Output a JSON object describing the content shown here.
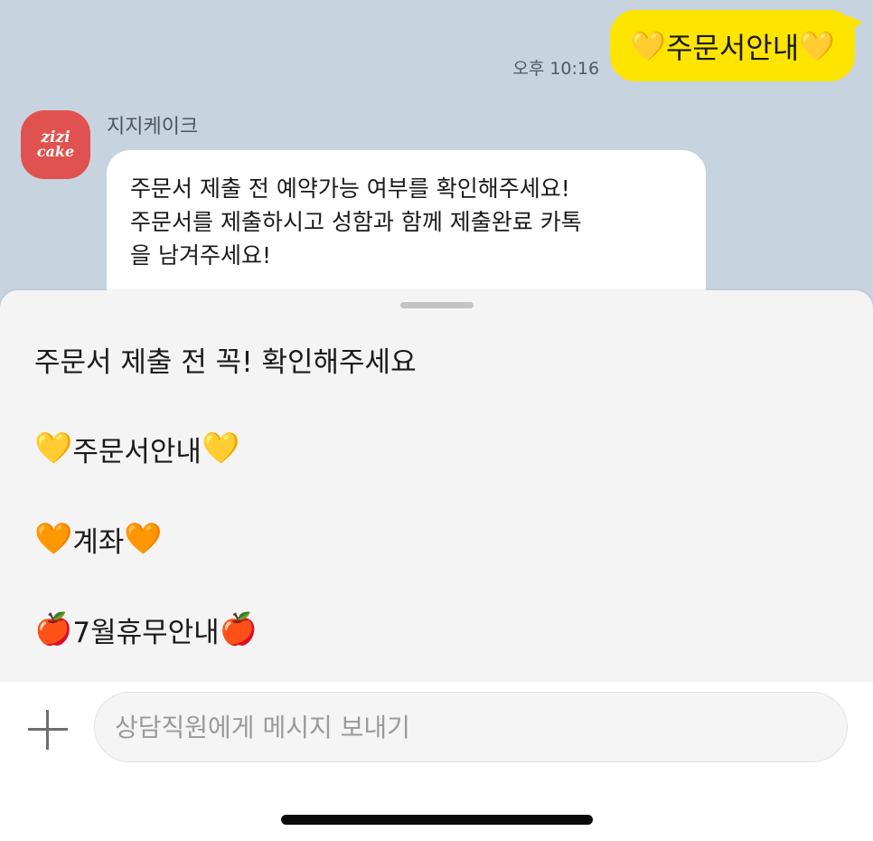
{
  "chat": {
    "sent": {
      "time": "오후 10:16",
      "emoji_left": "💛",
      "text": "주문서안내",
      "emoji_right": "💛"
    },
    "sender": {
      "name": "지지케이크",
      "avatar_line1": "zizi",
      "avatar_line2": "cake"
    },
    "received": {
      "lines": [
        "주문서 제출 전 예약가능 여부를 확인해주세요!",
        "주문서를 제출하시고 성함과 함께 제출완료 카톡",
        "을 남겨주세요!"
      ]
    }
  },
  "sheet": {
    "title": "주문서 제출 전 꼭! 확인해주세요",
    "items": [
      {
        "emoji_left": "💛",
        "label": "주문서안내",
        "emoji_right": "💛"
      },
      {
        "emoji_left": "🧡",
        "label": "계좌",
        "emoji_right": "🧡"
      },
      {
        "emoji_left": "🍎",
        "label": "7월휴무안내",
        "emoji_right": "🍎"
      }
    ]
  },
  "composer": {
    "placeholder": "상담직원에게 메시지 보내기"
  },
  "colors": {
    "chat_background": "#c7d3df",
    "sent_bubble": "#fee500",
    "avatar": "#e0524f"
  }
}
